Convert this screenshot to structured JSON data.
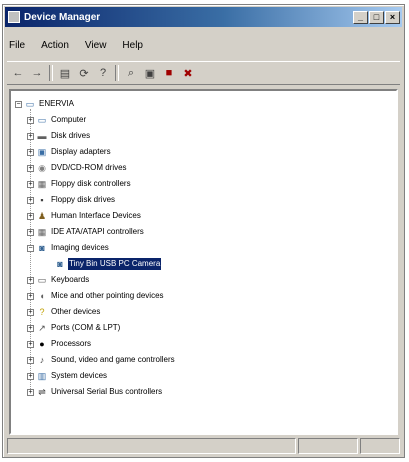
{
  "window": {
    "title": "Device Manager",
    "buttons": {
      "minimize": "_",
      "maximize": "□",
      "close": "×"
    }
  },
  "menu": [
    "File",
    "Action",
    "View",
    "Help"
  ],
  "toolbar": [
    "back",
    "forward",
    "properties",
    "refresh",
    "help",
    "scan",
    "update",
    "disable",
    "uninstall"
  ],
  "tree": {
    "root": "ENERVIA",
    "items": [
      {
        "label": "Computer",
        "icon": "computer-icon"
      },
      {
        "label": "Disk drives",
        "icon": "disk-drive-icon"
      },
      {
        "label": "Display adapters",
        "icon": "display-icon"
      },
      {
        "label": "DVD/CD-ROM drives",
        "icon": "cdrom-icon"
      },
      {
        "label": "Floppy disk controllers",
        "icon": "controller-icon"
      },
      {
        "label": "Floppy disk drives",
        "icon": "floppy-icon"
      },
      {
        "label": "Human Interface Devices",
        "icon": "hid-icon"
      },
      {
        "label": "IDE ATA/ATAPI controllers",
        "icon": "ide-icon"
      },
      {
        "label": "Imaging devices",
        "icon": "camera-icon",
        "expanded": true,
        "children": [
          {
            "label": "Tiny Bin USB PC Camera",
            "icon": "camera-icon",
            "selected": true
          }
        ]
      },
      {
        "label": "Keyboards",
        "icon": "keyboard-icon"
      },
      {
        "label": "Mice and other pointing devices",
        "icon": "mouse-icon"
      },
      {
        "label": "Other devices",
        "icon": "question-icon"
      },
      {
        "label": "Ports (COM & LPT)",
        "icon": "port-icon"
      },
      {
        "label": "Processors",
        "icon": "processor-icon"
      },
      {
        "label": "Sound, video and game controllers",
        "icon": "sound-icon"
      },
      {
        "label": "System devices",
        "icon": "system-icon"
      },
      {
        "label": "Universal Serial Bus controllers",
        "icon": "usb-icon"
      }
    ]
  }
}
